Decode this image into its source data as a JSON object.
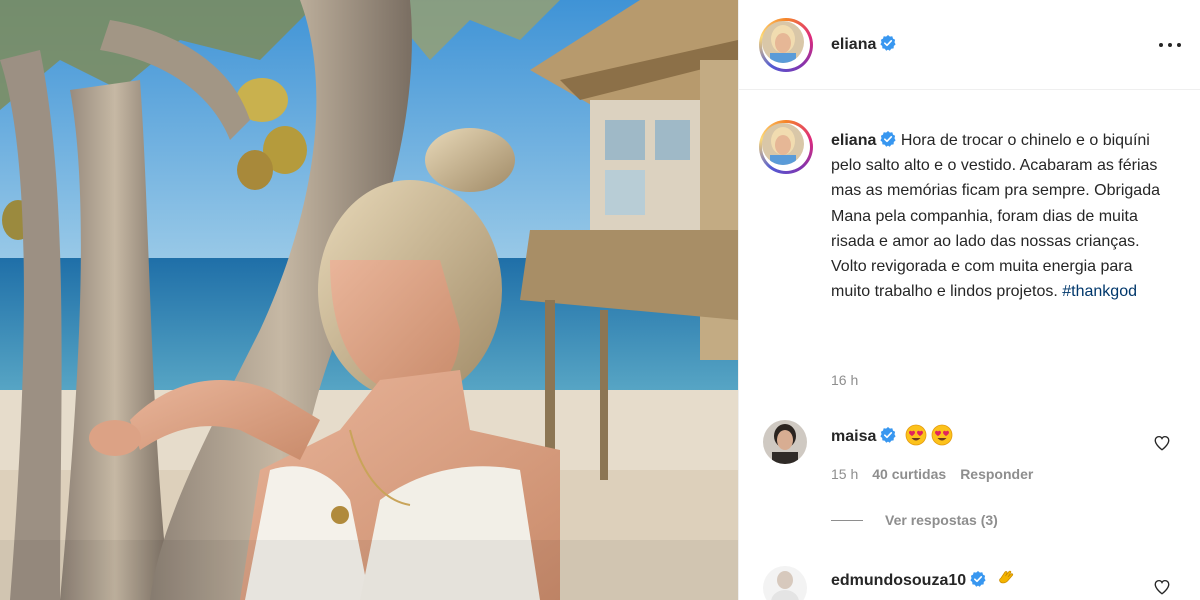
{
  "post": {
    "author": "eliana",
    "caption": "Hora de trocar o chinelo e o biquíni pelo salto alto e o vestido. Acabaram as férias mas as memórias ficam pra sempre. Obrigada Mana pela companhia, foram dias de muita risada e amor ao lado das nossas crianças. Volto revigorada e com muita energia para muito trabalho e lindos projetos.",
    "hashtag": "#thankgod",
    "time": "16 h"
  },
  "comments": [
    {
      "username": "maisa",
      "emojis": [
        "heart-eyes-emoji",
        "heart-eyes-emoji"
      ],
      "time": "15 h",
      "likes": "40 curtidas",
      "reply": "Responder",
      "view_replies": "Ver respostas (3)"
    },
    {
      "username": "edmundosouza10",
      "emojis": [
        "clapping-hands-emoji"
      ]
    }
  ],
  "colors": {
    "verified": "#3897f0",
    "hashtag": "#00376b",
    "secondary_text": "#8e8e8e",
    "primary_text": "#262626"
  }
}
